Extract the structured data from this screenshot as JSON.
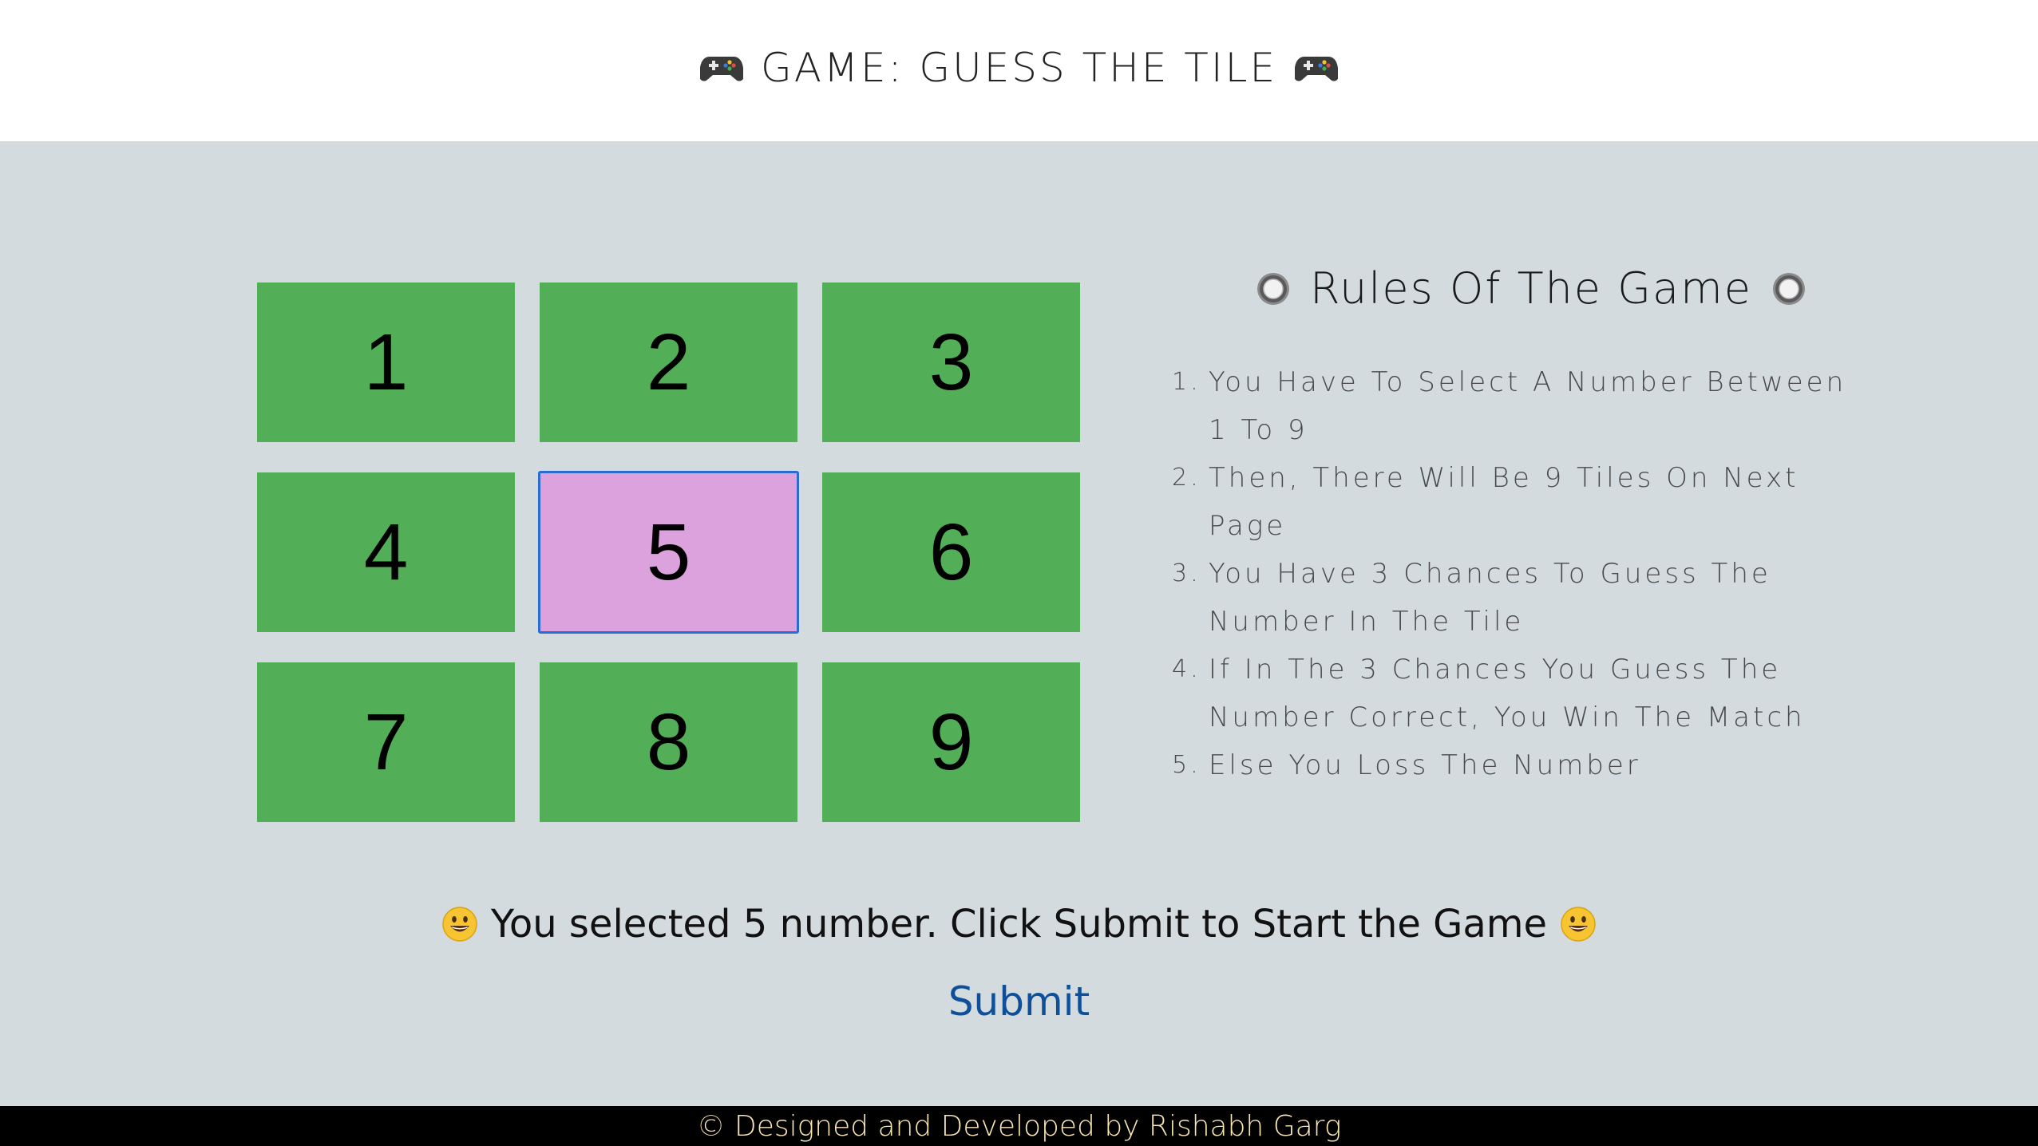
{
  "header": {
    "title": "GAME: GUESS THE TILE",
    "left_icon": "gamepad-icon",
    "right_icon": "gamepad-icon"
  },
  "board": {
    "tiles": [
      "1",
      "2",
      "3",
      "4",
      "5",
      "6",
      "7",
      "8",
      "9"
    ],
    "selected": "5",
    "tile_color": "#52ae57",
    "selected_color": "#dba2de",
    "selected_border": "#2a6cd4"
  },
  "rules": {
    "title": "Rules Of The Game",
    "icon": "radio-button-icon",
    "items": [
      {
        "num": "1.",
        "text": "You Have To Select A Number Between 1 To 9"
      },
      {
        "num": "2.",
        "text": "Then, There Will Be 9 Tiles On Next Page"
      },
      {
        "num": "3.",
        "text": "You Have 3 Chances To Guess The Number In The Tile"
      },
      {
        "num": "4.",
        "text": "If In The 3 Chances You Guess The Number Correct, You Win The Match"
      },
      {
        "num": "5.",
        "text": "Else You Loss The Number"
      }
    ]
  },
  "status": {
    "message": "You selected 5 number. Click Submit to Start the Game",
    "icon": "smiley-icon"
  },
  "submit": {
    "label": "Submit"
  },
  "footer": {
    "text": "© Designed and Developed by Rishabh Garg"
  },
  "colors": {
    "header_bg": "#ffffff",
    "main_bg": "#d3dbdf",
    "footer_bg": "#000000",
    "footer_text": "#fbe7b6",
    "submit_text": "#0e4f9a"
  }
}
